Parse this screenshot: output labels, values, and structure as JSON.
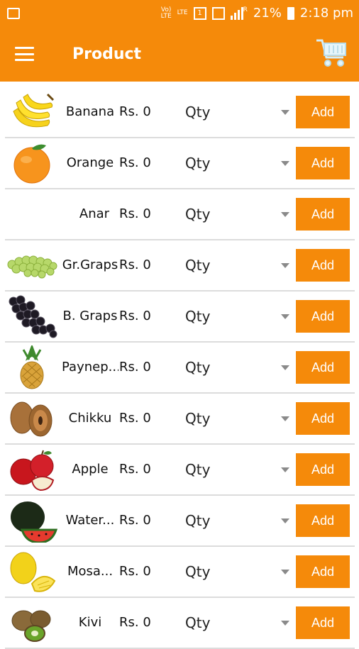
{
  "status_bar": {
    "network_top": "Vo)",
    "network_bottom": "LTE",
    "lte_label": "LTE",
    "sim_number": "1",
    "signal_r": "R",
    "battery": "21%",
    "time": "2:18 pm"
  },
  "app_bar": {
    "title": "Product"
  },
  "colors": {
    "accent": "#f58a0a",
    "background": "#ffffff",
    "divider": "#dcdcdc"
  },
  "products": [
    {
      "name": "Banana",
      "price": "Rs. 0",
      "qty": "Qty",
      "add": "Add",
      "icon": "banana-icon"
    },
    {
      "name": "Orange",
      "price": "Rs. 0",
      "qty": "Qty",
      "add": "Add",
      "icon": "orange-icon"
    },
    {
      "name": "Anar",
      "price": "Rs. 0",
      "qty": "Qty",
      "add": "Add",
      "icon": ""
    },
    {
      "name": "Gr.Graps",
      "price": "Rs. 0",
      "qty": "Qty",
      "add": "Add",
      "icon": "green-grapes-icon"
    },
    {
      "name": "B. Graps",
      "price": "Rs. 0",
      "qty": "Qty",
      "add": "Add",
      "icon": "black-grapes-icon"
    },
    {
      "name": "Paynep...",
      "price": "Rs. 0",
      "qty": "Qty",
      "add": "Add",
      "icon": "pineapple-icon"
    },
    {
      "name": "Chikku",
      "price": "Rs. 0",
      "qty": "Qty",
      "add": "Add",
      "icon": "chikku-icon"
    },
    {
      "name": "Apple",
      "price": "Rs. 0",
      "qty": "Qty",
      "add": "Add",
      "icon": "apple-icon"
    },
    {
      "name": "Water...",
      "price": "Rs. 0",
      "qty": "Qty",
      "add": "Add",
      "icon": "watermelon-icon"
    },
    {
      "name": "Mosa...",
      "price": "Rs. 0",
      "qty": "Qty",
      "add": "Add",
      "icon": "mosambi-icon"
    },
    {
      "name": "Kivi",
      "price": "Rs. 0",
      "qty": "Qty",
      "add": "Add",
      "icon": "kiwi-icon"
    }
  ]
}
